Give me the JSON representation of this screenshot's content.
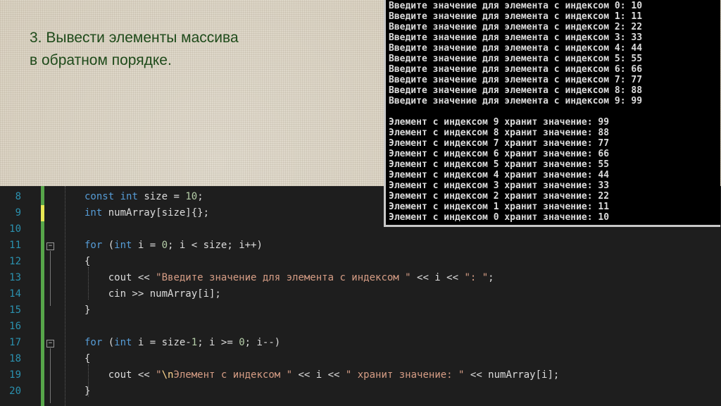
{
  "slide": {
    "title_line1": "3.  Вывести элементы массива",
    "title_line2": "в обратном порядке."
  },
  "code_lines": [
    {
      "ln": "8",
      "text": "const int size = 10;"
    },
    {
      "ln": "9",
      "text": "int numArray[size]{};"
    },
    {
      "ln": "10",
      "text": ""
    },
    {
      "ln": "11",
      "text": "for (int i = 0; i < size; i++)"
    },
    {
      "ln": "12",
      "text": "{"
    },
    {
      "ln": "13",
      "text": "    cout << \"Введите значение для элемента с индексом \" << i << \": \";"
    },
    {
      "ln": "14",
      "text": "    cin >> numArray[i];"
    },
    {
      "ln": "15",
      "text": "}"
    },
    {
      "ln": "16",
      "text": ""
    },
    {
      "ln": "17",
      "text": "for (int i = size-1; i >= 0; i--)"
    },
    {
      "ln": "18",
      "text": "{"
    },
    {
      "ln": "19",
      "text": "    cout << \"\\nЭлемент с индексом \" << i << \" хранит значение: \" << numArray[i];"
    },
    {
      "ln": "20",
      "text": "}"
    }
  ],
  "console_lines": [
    "Введите значение для элемента с индексом 0: 10",
    "Введите значение для элемента с индексом 1: 11",
    "Введите значение для элемента с индексом 2: 22",
    "Введите значение для элемента с индексом 3: 33",
    "Введите значение для элемента с индексом 4: 44",
    "Введите значение для элемента с индексом 5: 55",
    "Введите значение для элемента с индексом 6: 66",
    "Введите значение для элемента с индексом 7: 77",
    "Введите значение для элемента с индексом 8: 88",
    "Введите значение для элемента с индексом 9: 99",
    "",
    "Элемент с индексом 9 хранит значение: 99",
    "Элемент с индексом 8 хранит значение: 88",
    "Элемент с индексом 7 хранит значение: 77",
    "Элемент с индексом 6 хранит значение: 66",
    "Элемент с индексом 5 хранит значение: 55",
    "Элемент с индексом 4 хранит значение: 44",
    "Элемент с индексом 3 хранит значение: 33",
    "Элемент с индексом 2 хранит значение: 22",
    "Элемент с индексом 1 хранит значение: 11",
    "Элемент с индексом 0 хранит значение: 10"
  ],
  "colors": {
    "editor_bg": "#1e1e1e",
    "keyword": "#569cd6",
    "string": "#d69d85",
    "number": "#b5cea8",
    "line_number": "#2b91af",
    "change_bar": "#57a64a",
    "title_text": "#1e4a1a"
  }
}
